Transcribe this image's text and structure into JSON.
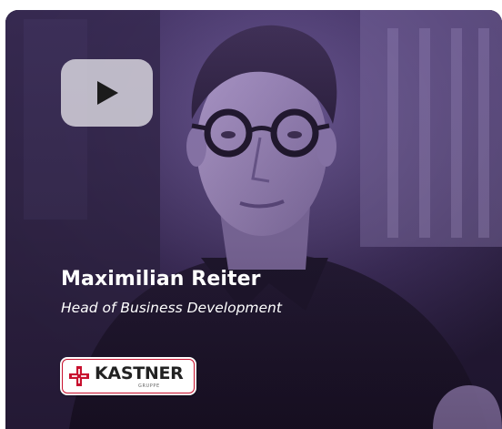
{
  "video_card": {
    "play_button_label": "Play video",
    "person": {
      "name": "Maximilian Reiter",
      "role": "Head of Business Development"
    },
    "company_logo": {
      "wordmark": "KASTNER",
      "subtext": "GRUPPE",
      "brand_color": "#c8102e"
    },
    "overlay_tint": "#5c4696"
  }
}
